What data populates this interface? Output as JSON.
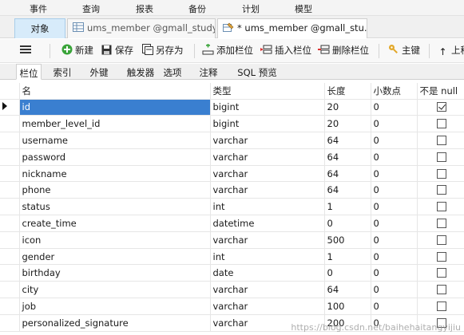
{
  "menu": {
    "items": [
      "事件",
      "查询",
      "报表",
      "备份",
      "计划",
      "模型"
    ]
  },
  "tabs": {
    "objects_label": "对象",
    "tab1_label": "ums_member @gmall_study...",
    "tab2_label": "* ums_member @gmall_stu..."
  },
  "toolbar": {
    "new_label": "新建",
    "save_label": "保存",
    "save_as_label": "另存为",
    "add_field_label": "添加栏位",
    "insert_field_label": "插入栏位",
    "delete_field_label": "删除栏位",
    "primary_key_label": "主键",
    "move_up_label": "上移"
  },
  "subtabs": [
    "栏位",
    "索引",
    "外键",
    "触发器",
    "选项",
    "注释",
    "SQL 预览"
  ],
  "table": {
    "headers": [
      "名",
      "类型",
      "长度",
      "小数点",
      "不是 null"
    ],
    "rows": [
      {
        "name": "id",
        "type": "bigint",
        "length": "20",
        "decimals": "0",
        "not_null": true
      },
      {
        "name": "member_level_id",
        "type": "bigint",
        "length": "20",
        "decimals": "0",
        "not_null": false
      },
      {
        "name": "username",
        "type": "varchar",
        "length": "64",
        "decimals": "0",
        "not_null": false
      },
      {
        "name": "password",
        "type": "varchar",
        "length": "64",
        "decimals": "0",
        "not_null": false
      },
      {
        "name": "nickname",
        "type": "varchar",
        "length": "64",
        "decimals": "0",
        "not_null": false
      },
      {
        "name": "phone",
        "type": "varchar",
        "length": "64",
        "decimals": "0",
        "not_null": false
      },
      {
        "name": "status",
        "type": "int",
        "length": "1",
        "decimals": "0",
        "not_null": false
      },
      {
        "name": "create_time",
        "type": "datetime",
        "length": "0",
        "decimals": "0",
        "not_null": false
      },
      {
        "name": "icon",
        "type": "varchar",
        "length": "500",
        "decimals": "0",
        "not_null": false
      },
      {
        "name": "gender",
        "type": "int",
        "length": "1",
        "decimals": "0",
        "not_null": false
      },
      {
        "name": "birthday",
        "type": "date",
        "length": "0",
        "decimals": "0",
        "not_null": false
      },
      {
        "name": "city",
        "type": "varchar",
        "length": "64",
        "decimals": "0",
        "not_null": false
      },
      {
        "name": "job",
        "type": "varchar",
        "length": "100",
        "decimals": "0",
        "not_null": false
      },
      {
        "name": "personalized_signature",
        "type": "varchar",
        "length": "200",
        "decimals": "0",
        "not_null": false
      }
    ]
  },
  "watermark": "https://blog.csdn.net/baihehaitangyijiu",
  "colors": {
    "selection": "#3a7fd0",
    "active_tab": "#d7ebfa"
  }
}
